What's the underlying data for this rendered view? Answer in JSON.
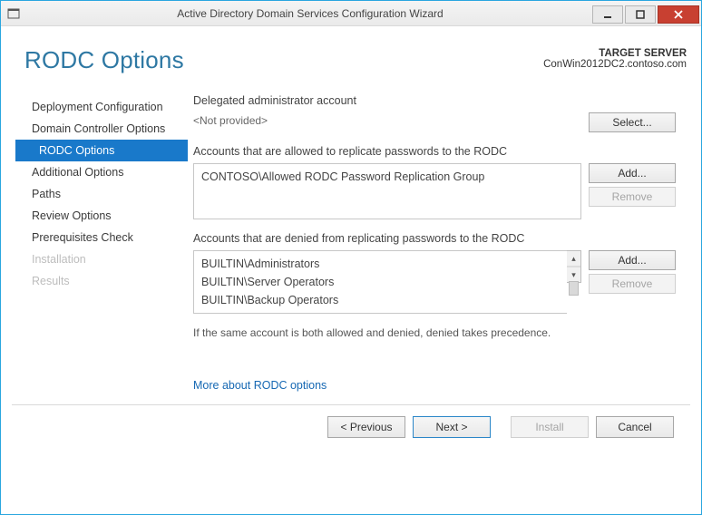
{
  "window": {
    "title": "Active Directory Domain Services Configuration Wizard"
  },
  "page": {
    "title": "RODC Options",
    "target_label": "TARGET SERVER",
    "target_server": "ConWin2012DC2.contoso.com"
  },
  "nav": {
    "items": [
      {
        "label": "Deployment Configuration",
        "state": "normal"
      },
      {
        "label": "Domain Controller Options",
        "state": "normal"
      },
      {
        "label": "RODC Options",
        "state": "selected"
      },
      {
        "label": "Additional Options",
        "state": "normal"
      },
      {
        "label": "Paths",
        "state": "normal"
      },
      {
        "label": "Review Options",
        "state": "normal"
      },
      {
        "label": "Prerequisites Check",
        "state": "normal"
      },
      {
        "label": "Installation",
        "state": "disabled"
      },
      {
        "label": "Results",
        "state": "disabled"
      }
    ]
  },
  "delegated": {
    "label": "Delegated administrator account",
    "value": "<Not provided>",
    "select_btn": "Select..."
  },
  "allowed": {
    "label": "Accounts that are allowed to replicate passwords to the RODC",
    "items": [
      "CONTOSO\\Allowed RODC Password Replication Group"
    ],
    "add_btn": "Add...",
    "remove_btn": "Remove"
  },
  "denied": {
    "label": "Accounts that are denied from replicating passwords to the RODC",
    "items": [
      "BUILTIN\\Administrators",
      "BUILTIN\\Server Operators",
      "BUILTIN\\Backup Operators"
    ],
    "add_btn": "Add...",
    "remove_btn": "Remove"
  },
  "hint": "If the same account is both allowed and denied, denied takes precedence.",
  "more_link": "More about RODC options",
  "footer": {
    "previous": "< Previous",
    "next": "Next >",
    "install": "Install",
    "cancel": "Cancel"
  }
}
